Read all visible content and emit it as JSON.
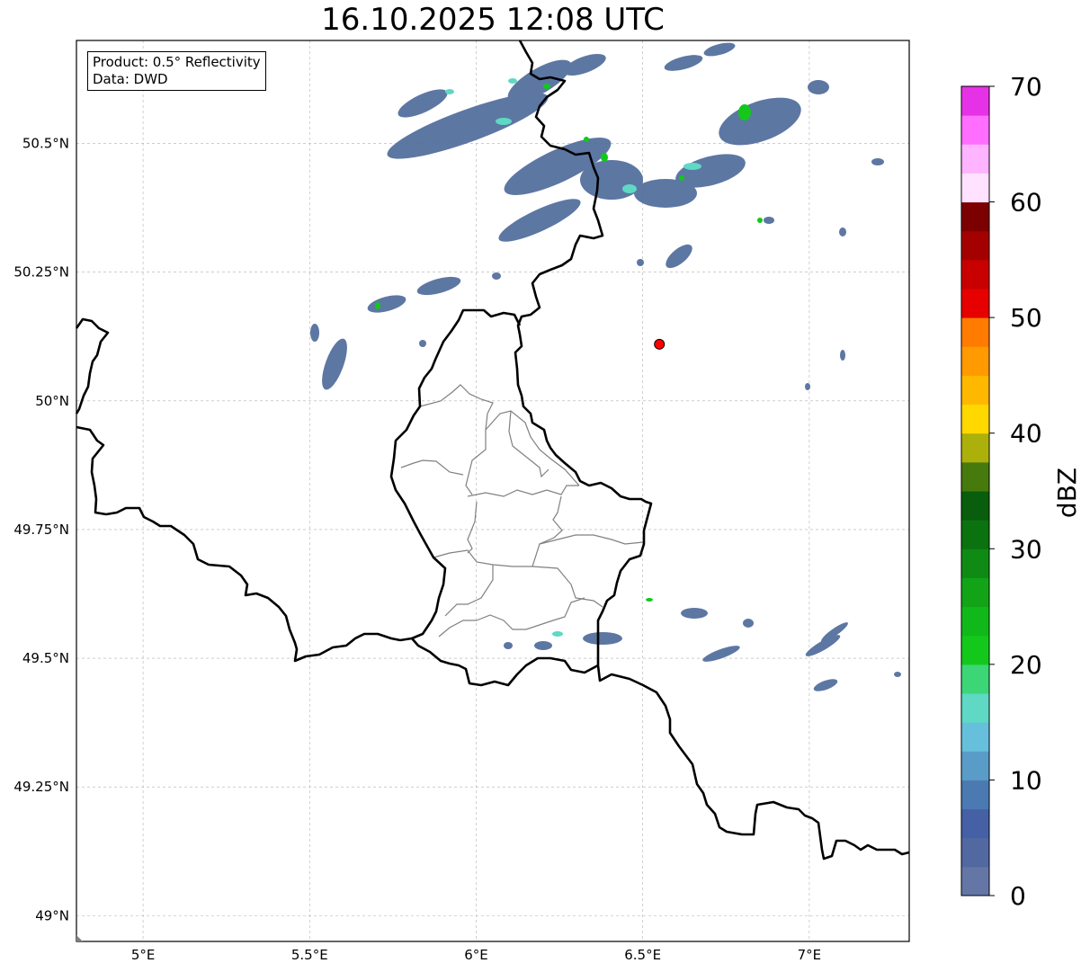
{
  "title": "16.10.2025 12:08 UTC",
  "info_box": {
    "product": "Product: 0.5° Reflectivity",
    "data": "Data: DWD"
  },
  "map": {
    "lon_range": [
      4.8,
      7.3
    ],
    "lat_range": [
      48.95,
      50.7
    ],
    "grid": true,
    "lon_ticks": [
      {
        "value": 5.0,
        "label": "5°E"
      },
      {
        "value": 5.5,
        "label": "5.5°E"
      },
      {
        "value": 6.0,
        "label": "6°E"
      },
      {
        "value": 6.5,
        "label": "6.5°E"
      },
      {
        "value": 7.0,
        "label": "7°E"
      }
    ],
    "lat_ticks": [
      {
        "value": 49.0,
        "label": "49°N"
      },
      {
        "value": 49.25,
        "label": "49.25°N"
      },
      {
        "value": 49.5,
        "label": "49.5°N"
      },
      {
        "value": 49.75,
        "label": "49.75°N"
      },
      {
        "value": 50.0,
        "label": "50°N"
      },
      {
        "value": 50.25,
        "label": "50.25°N"
      },
      {
        "value": 50.5,
        "label": "50.5°N"
      }
    ],
    "radar_site": {
      "lon": 6.55,
      "lat": 50.11,
      "color": "#ff0000"
    }
  },
  "colorbar": {
    "label": "dBZ",
    "min": 0,
    "max": 70,
    "step": 2.5,
    "tick_values": [
      0,
      10,
      20,
      30,
      40,
      50,
      60,
      70
    ],
    "tick_labels": [
      "0",
      "10",
      "20",
      "30",
      "40",
      "50",
      "60",
      "70"
    ],
    "colors": [
      "#6476a6",
      "#5268a0",
      "#4560a4",
      "#4b7ab2",
      "#5a9cc8",
      "#66c0db",
      "#5fd8c4",
      "#3cd677",
      "#13c81b",
      "#10b81a",
      "#12a416",
      "#0f8a14",
      "#0b7210",
      "#085e0c",
      "#467a0c",
      "#acb00a",
      "#ffd800",
      "#ffb800",
      "#ff9a00",
      "#ff7c00",
      "#e60000",
      "#c80000",
      "#a40000",
      "#7c0000",
      "#ffe2ff",
      "#ffb4ff",
      "#ff6eff",
      "#e632e6"
    ]
  }
}
